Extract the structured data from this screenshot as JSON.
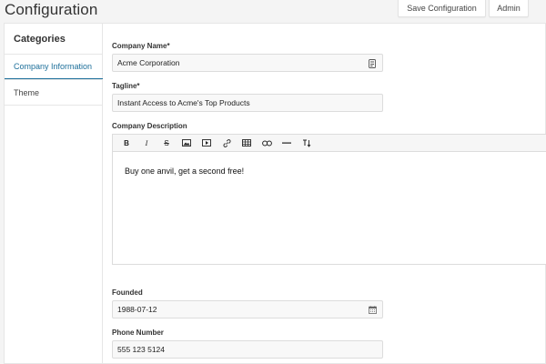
{
  "page": {
    "title": "Configuration"
  },
  "top_actions": {
    "save_label": "Save Configuration",
    "admin_label": "Admin"
  },
  "sidebar": {
    "heading": "Categories",
    "items": [
      {
        "label": "Company Information",
        "active": true
      },
      {
        "label": "Theme",
        "active": false
      }
    ]
  },
  "form": {
    "company_name": {
      "label": "Company Name*",
      "value": "Acme Corporation",
      "icon": "contact-card-icon"
    },
    "tagline": {
      "label": "Tagline*",
      "value": "Instant Access to Acme's Top Products"
    },
    "description": {
      "label": "Company Description",
      "content": "Buy one anvil, get a second free!",
      "toolbar": [
        "bold",
        "italic",
        "strikethrough",
        "image",
        "video",
        "link",
        "table",
        "embed",
        "horizontal-rule",
        "text-direction"
      ]
    },
    "founded": {
      "label": "Founded",
      "value": "1988-07-12",
      "icon": "calendar-icon"
    },
    "phone": {
      "label": "Phone Number",
      "value": "555 123 5124"
    }
  },
  "colors": {
    "accent": "#1d6f9a",
    "border": "#dcdcdc",
    "background": "#f4f4f4"
  }
}
